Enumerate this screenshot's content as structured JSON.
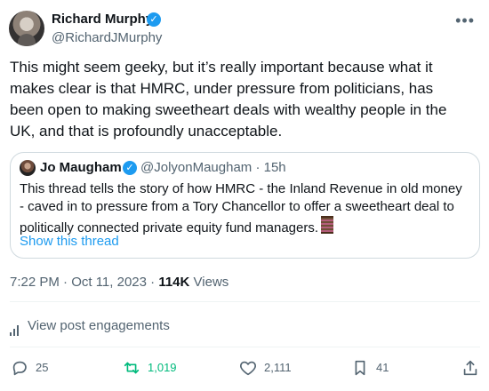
{
  "author": {
    "name": "Richard Murphy",
    "handle": "@RichardJMurphy"
  },
  "tweet": {
    "text": "This might seem geeky, but it’s really important because what it makes clear is that HMRC, under pressure from politicians, has been open to making sweetheart deals with wealthy people in the UK, and that is profoundly unacceptable."
  },
  "quoted": {
    "name": "Jo Maugham",
    "handle": "@JolyonMaugham",
    "time": "15h",
    "meta": "@JolyonMaugham · 15h",
    "text": "This thread tells the story of how HMRC - the Inland Revenue in old money - caved in to pressure from a Tory Chancellor to offer a sweetheart deal to politically connected private equity fund managers.",
    "link": "Show this thread"
  },
  "timestamp": {
    "text": "7:22 PM · Oct 11, 2023 ·",
    "views_count": "114K",
    "views_label": "Views"
  },
  "engagements": {
    "label": "View post engagements"
  },
  "actions": {
    "replies": "25",
    "reposts": "1,019",
    "likes": "2,111",
    "bookmarks": "41"
  },
  "colors": {
    "text": "#0f1419",
    "muted": "#536471",
    "accent": "#1d9bf0",
    "repost": "#00ba7c",
    "border": "#cfd9de"
  },
  "icons": {
    "verified": "verified-badge-icon",
    "more": "more-icon",
    "analytics": "analytics-icon",
    "reply": "reply-icon",
    "repost": "repost-icon",
    "like": "heart-icon",
    "bookmark": "bookmark-icon",
    "share": "share-icon"
  }
}
